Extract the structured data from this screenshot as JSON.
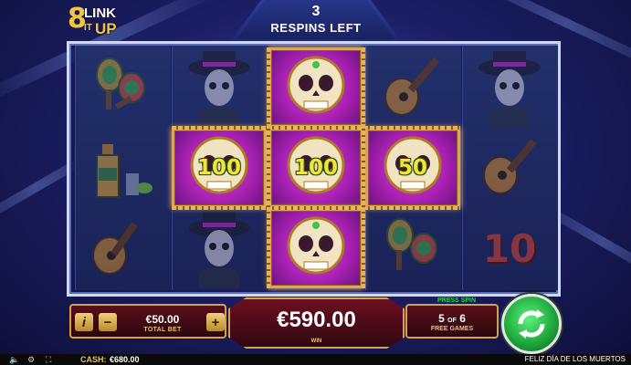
{
  "logo": {
    "eight": "8",
    "link": "LINK",
    "it": "IT",
    "up": "UP"
  },
  "respins": {
    "count": "3",
    "label": "RESPINS LEFT"
  },
  "reels": {
    "col1": [
      "maracas-symbol",
      "tequila-symbol",
      "guitar-symbol"
    ],
    "col2": [
      "skeleton-man-symbol",
      "skull-coin",
      "skeleton-man-symbol"
    ],
    "col3": [
      "skull-coin",
      "skull-coin",
      "skull-coin"
    ],
    "col4": [
      "guitar-symbol",
      "skull-coin",
      "maracas-symbol"
    ],
    "col5": [
      "skeleton-man-symbol",
      "guitar-symbol",
      "ten-symbol"
    ]
  },
  "coins": {
    "mid_left": "100",
    "mid_center": "100",
    "mid_right": "50"
  },
  "ten_symbol": "10",
  "controls": {
    "info_label": "i",
    "minus_label": "−",
    "plus_label": "+",
    "total_bet_value": "€50.00",
    "total_bet_label": "TOTAL BET",
    "win_value": "€590.00",
    "win_label": "WIN",
    "press_spin_label": "PRESS SPIN",
    "free_games_current": "5",
    "free_games_of": "OF",
    "free_games_total": "6",
    "free_games_label": "FREE GAMES"
  },
  "footer": {
    "cash_label": "CASH:",
    "cash_value": "€680.00",
    "game_name": "FELIZ DÍA DE LOS MUERTOS"
  },
  "colors": {
    "coin_magenta": "#c12ac4",
    "coin_value_yellow": "#f6e23b",
    "gold_border": "#d3a24d",
    "spin_green": "#1faa3d"
  }
}
